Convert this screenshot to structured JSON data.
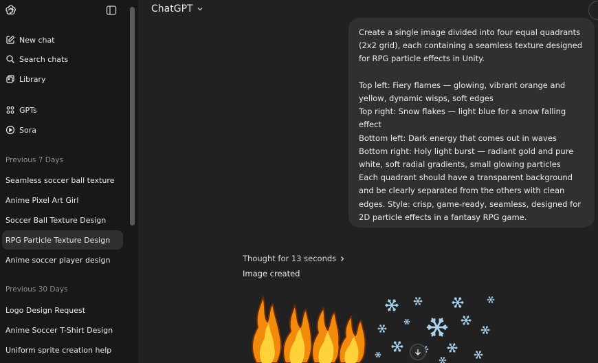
{
  "sidebar": {
    "logo_icon": "openai-logo-icon",
    "toggle_icon": "sidebar-toggle-icon",
    "actions": [
      {
        "label": "New chat",
        "icon": "edit-icon"
      },
      {
        "label": "Search chats",
        "icon": "search-icon"
      },
      {
        "label": "Library",
        "icon": "library-icon"
      },
      {
        "label": "GPTs",
        "icon": "grid-icon"
      },
      {
        "label": "Sora",
        "icon": "play-circle-icon"
      }
    ],
    "sections": [
      {
        "title": "Previous 7 Days",
        "items": [
          {
            "label": "Seamless soccer ball texture"
          },
          {
            "label": "Anime Pixel Art Girl"
          },
          {
            "label": "Soccer Ball Texture Design"
          },
          {
            "label": "RPG Particle Texture Design",
            "active": true
          },
          {
            "label": "Anime soccer player design"
          }
        ]
      },
      {
        "title": "Previous 30 Days",
        "items": [
          {
            "label": "Logo Design Request"
          },
          {
            "label": "Anime Soccer T-Shirt Design"
          },
          {
            "label": "Uniform sprite creation help"
          }
        ]
      }
    ]
  },
  "header": {
    "model_name": "ChatGPT",
    "chevron_icon": "chevron-down-icon"
  },
  "conversation": {
    "user_message_lines": [
      "Create a single image divided into four equal quadrants",
      "(2x2 grid), each containing a seamless texture designed",
      "for RPG particle effects in Unity.",
      "",
      "Top left: Fiery flames — glowing, vibrant orange and",
      "yellow, dynamic wisps, soft edges",
      "Top right: Snow flakes — light blue for a snow falling",
      "effect",
      "Bottom left: Dark energy that comes out in waves",
      "Bottom right: Holy light burst — radiant gold and pure",
      "white, soft radial gradients, small glowing particles",
      "Each quadrant should have a transparent background",
      "and be clearly separated from the others with clean",
      "edges. Style: crisp, game-ready, seamless, designed for",
      "2D particle effects in a fantasy RPG game."
    ],
    "thought_label": "Thought for 13 seconds",
    "image_status": "Image created",
    "colors": {
      "flame_outer": "#f28a0c",
      "flame_inner": "#ffd23a",
      "flame_outline": "#6b2a05",
      "snow": "#a9d4ee"
    }
  }
}
